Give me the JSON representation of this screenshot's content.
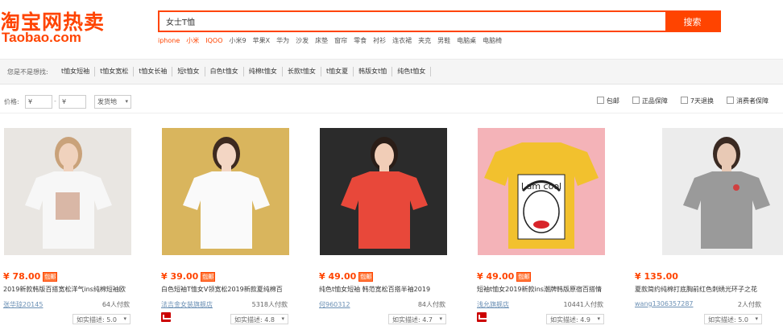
{
  "header": {
    "logo_cn": "淘宝网热卖",
    "logo_en": "Taobao.com",
    "search_value": "女士T恤",
    "search_button": "搜索",
    "hot_words": [
      {
        "label": "iphone",
        "highlight": true
      },
      {
        "label": "小米",
        "highlight": true
      },
      {
        "label": "IQOO",
        "highlight": true
      },
      {
        "label": "小米9",
        "highlight": false
      },
      {
        "label": "苹果X",
        "highlight": false
      },
      {
        "label": "华为",
        "highlight": false
      },
      {
        "label": "沙发",
        "highlight": false
      },
      {
        "label": "床垫",
        "highlight": false
      },
      {
        "label": "窗帘",
        "highlight": false
      },
      {
        "label": "零食",
        "highlight": false
      },
      {
        "label": "衬衫",
        "highlight": false
      },
      {
        "label": "连衣裙",
        "highlight": false
      },
      {
        "label": "夹克",
        "highlight": false
      },
      {
        "label": "男鞋",
        "highlight": false
      },
      {
        "label": "电脑桌",
        "highlight": false
      },
      {
        "label": "电脑椅",
        "highlight": false
      }
    ]
  },
  "related": {
    "label": "您是不是想找:",
    "items": [
      "t恤女短袖",
      "t恤女宽松",
      "t恤女长袖",
      "短t恤女",
      "白色t恤女",
      "纯棉t恤女",
      "长款t恤女",
      "t恤女夏",
      "韩版女t恤",
      "纯色t恤女"
    ]
  },
  "filter": {
    "price_label": "价格:",
    "price_min": "¥",
    "price_max": "¥",
    "price_sep": "-",
    "ship_from": "发货地",
    "checks": [
      "包邮",
      "正品保障",
      "7天退换",
      "消费者保障"
    ]
  },
  "products": [
    {
      "price": "¥ 78.00",
      "badge": "包邮",
      "title": "2019新款韩版百搭宽松洋气ins纯棉短袖欧",
      "shop": "张华琼20145",
      "sold": "64人付款",
      "rating": "如实描述: 5.0",
      "has_shop_icon": false,
      "img_bg": "#e9e6e2",
      "shirt": "#f7f7f7",
      "hair": "#c9a27a",
      "skin": "#f0d2bd"
    },
    {
      "price": "¥ 39.00",
      "badge": "包邮",
      "title": "白色短袖T恤女V领宽松2019新款夏纯棉百",
      "shop": "法吉金女装旗舰店",
      "sold": "5318人付款",
      "rating": "如实描述: 4.8",
      "has_shop_icon": true,
      "img_bg": "#d9b55d",
      "shirt": "#fafafa",
      "hair": "#3d2a20",
      "skin": "#f3d6c4"
    },
    {
      "price": "¥ 49.00",
      "badge": "包邮",
      "title": "纯色t恤女短袖 韩范宽松百搭半袖2019",
      "shop": "何960312",
      "sold": "84人付款",
      "rating": "如实描述: 4.7",
      "has_shop_icon": false,
      "img_bg": "#2b2b2b",
      "shirt": "#e8483a",
      "hair": "#2a1d17",
      "skin": "#f1cdb7"
    },
    {
      "price": "¥ 49.00",
      "badge": "包邮",
      "title": "短袖t恤女2019新款ins潮牌韩版原宿百搭情",
      "shop": "浅允旗舰店",
      "sold": "10441人付款",
      "rating": "如实描述: 4.9",
      "has_shop_icon": true,
      "img_bg": "#f4b3b8",
      "shirt": "#f2c12e",
      "print_text": "I am cool"
    },
    {
      "price": "¥ 135.00",
      "badge": "",
      "title": "夏款简约纯棉打底胸前红色刺绣光环子之花",
      "shop": "wang1306357287",
      "sold": "2人付款",
      "rating": "如实描述: 5.0",
      "has_shop_icon": false,
      "img_bg": "#ececec",
      "shirt": "#9a9a9a",
      "hair": "#3a2a22",
      "skin": "#e8c9b5"
    }
  ],
  "icons": {
    "shop_icon": "tmall-shop-icon",
    "dropdown": "chevron-down-icon"
  }
}
